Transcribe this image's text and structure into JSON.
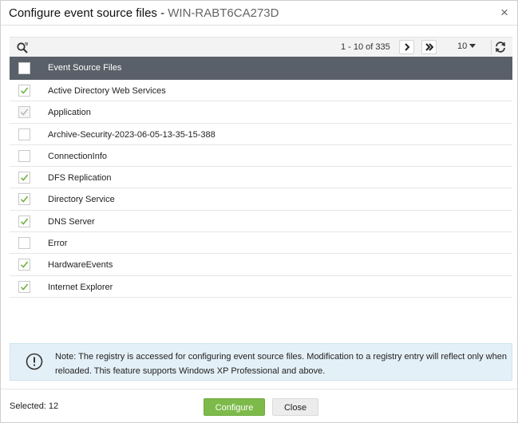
{
  "dialog": {
    "title": "Configure event source files - ",
    "host": "WIN-RABT6CA273D",
    "close_glyph": "×"
  },
  "toolbar": {
    "search_icon": "search-filter-icon",
    "pager_text": "1 - 10 of 335",
    "per_page": "10",
    "refresh_icon": "refresh-icon"
  },
  "table": {
    "header": "Event Source Files",
    "rows": [
      {
        "label": "Active Directory Web Services",
        "checked": true,
        "disabled": false
      },
      {
        "label": "Application",
        "checked": true,
        "disabled": true
      },
      {
        "label": "Archive-Security-2023-06-05-13-35-15-388",
        "checked": false,
        "disabled": false
      },
      {
        "label": "ConnectionInfo",
        "checked": false,
        "disabled": false
      },
      {
        "label": "DFS Replication",
        "checked": true,
        "disabled": false
      },
      {
        "label": "Directory Service",
        "checked": true,
        "disabled": false
      },
      {
        "label": "DNS Server",
        "checked": true,
        "disabled": false
      },
      {
        "label": "Error",
        "checked": false,
        "disabled": false
      },
      {
        "label": "HardwareEvents",
        "checked": true,
        "disabled": false
      },
      {
        "label": "Internet Explorer",
        "checked": true,
        "disabled": false
      }
    ]
  },
  "note": {
    "text": "Note: The registry is accessed for configuring event source files. Modification to a registry entry will reflect only when reloaded. This feature supports Windows XP Professional and above."
  },
  "footer": {
    "selected": "Selected: 12",
    "configure_label": "Configure",
    "close_label": "Close"
  },
  "colors": {
    "header_bg": "#596069",
    "check_green": "#6fb23e",
    "check_gray": "#b7b7b7",
    "primary_button": "#7dba4a",
    "note_bg": "#e4f0f7"
  }
}
